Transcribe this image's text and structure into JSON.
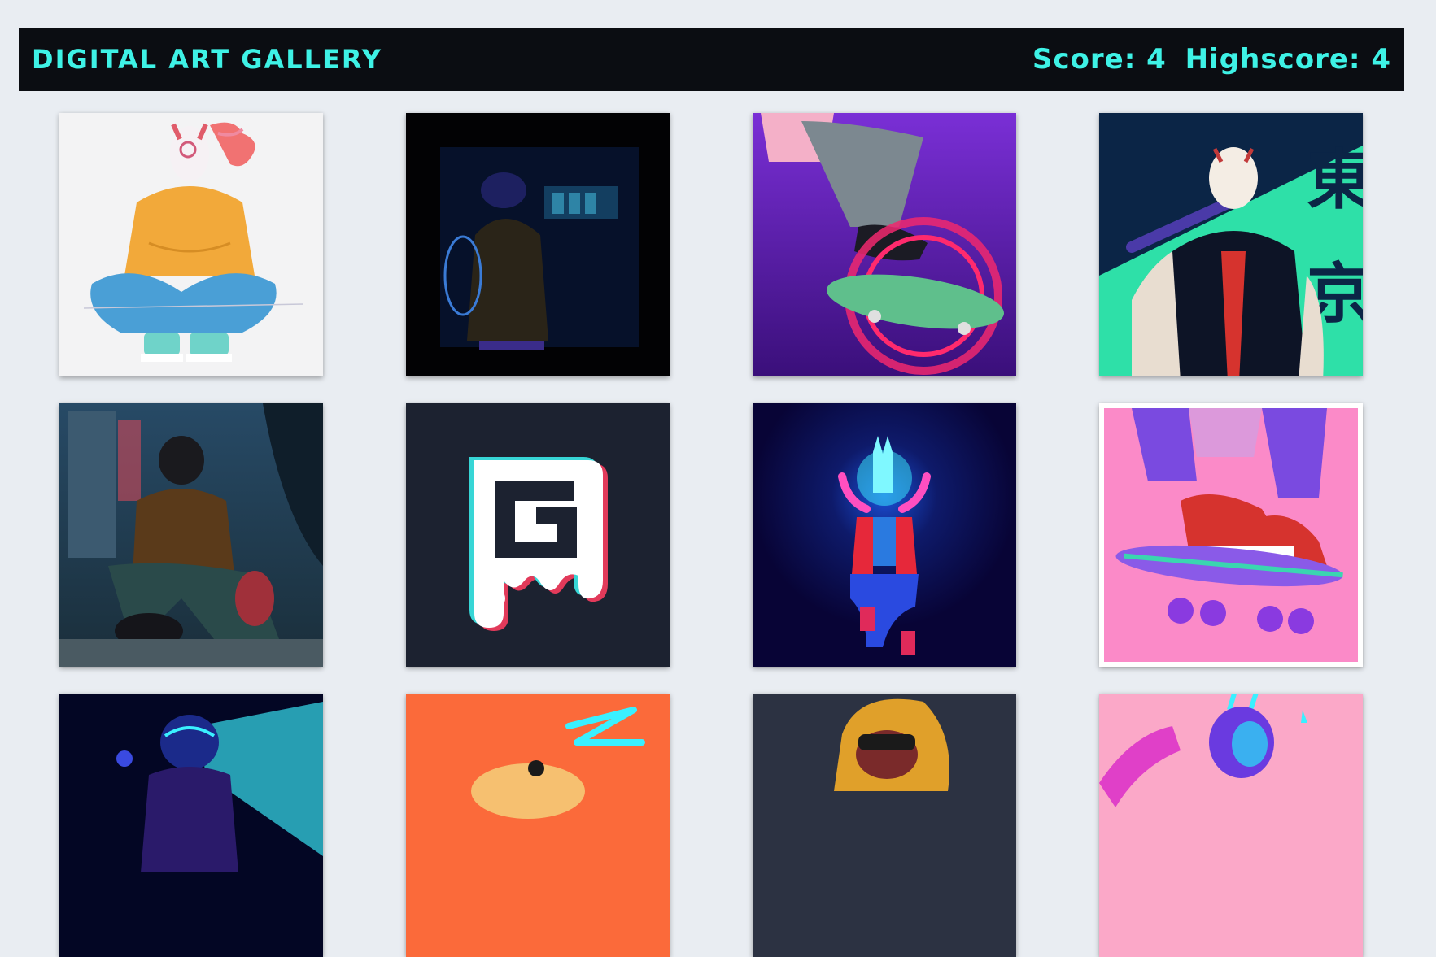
{
  "header": {
    "title": "DIGITAL ART GALLERY",
    "score_text": "Score: 4",
    "highscore_text": "Highscore: 4"
  },
  "colors": {
    "accent": "#3ef2e6",
    "header_bg": "#0b0d12",
    "page_bg": "#e9edf2"
  },
  "cards": [
    {
      "art": "fox-mask-yellow-hoodie"
    },
    {
      "art": "hooded-figure-dark-street"
    },
    {
      "art": "skateboard-neon-ring"
    },
    {
      "art": "fox-mask-bat-tokyo"
    },
    {
      "art": "sitting-figure-city-night"
    },
    {
      "art": "ghost-g-logo"
    },
    {
      "art": "neon-blue-fox-figure"
    },
    {
      "art": "sneakers-skateboard-pink"
    },
    {
      "art": "helmet-figure-cyan-light"
    },
    {
      "art": "orange-character-zigzag"
    },
    {
      "art": "yellow-hood-figure"
    },
    {
      "art": "purple-horned-character-pink"
    }
  ]
}
